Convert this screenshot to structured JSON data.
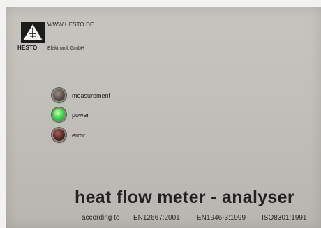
{
  "header": {
    "url": "WWW.HESTO.DE",
    "brand": "HESTO",
    "company": "Elektronik GmbH",
    "logo_icon": "hesto-logo-icon"
  },
  "indicators": [
    {
      "label": "measurement",
      "state": "off",
      "color": "#5a4e46"
    },
    {
      "label": "power",
      "state": "on",
      "color": "#39e14a"
    },
    {
      "label": "error",
      "state": "off",
      "color": "#5c2523"
    }
  ],
  "title": "heat flow meter - analyser",
  "standards": {
    "prefix": "according to",
    "items": [
      "EN12667:2001",
      "EN1946-3:1999",
      "ISO8301:1991"
    ]
  }
}
